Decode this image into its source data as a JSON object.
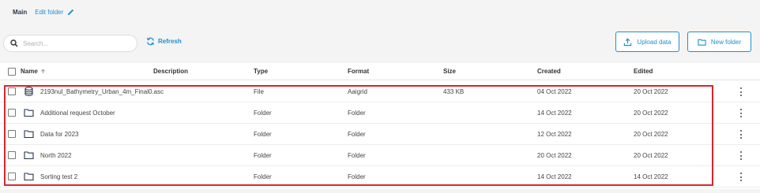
{
  "breadcrumb": {
    "main": "Main",
    "edit_folder": "Edit folder"
  },
  "toolbar": {
    "search_placeholder": "Search...",
    "refresh_label": "Refresh",
    "upload_label": "Upload data",
    "new_folder_label": "New folder"
  },
  "table": {
    "headers": {
      "name": "Name",
      "description": "Description",
      "type": "Type",
      "format": "Format",
      "size": "Size",
      "created": "Created",
      "edited": "Edited"
    },
    "rows": [
      {
        "icon": "database-file-icon",
        "name": "2193nul_Bathymetry_Urban_4m_Final0.asc",
        "type": "File",
        "format": "Aaigrid",
        "size": "433 KB",
        "created": "04 Oct 2022",
        "edited": "20 Oct 2022"
      },
      {
        "icon": "folder-icon",
        "name": "Additional request October",
        "type": "Folder",
        "format": "Folder",
        "size": "",
        "created": "14 Oct 2022",
        "edited": "20 Oct 2022"
      },
      {
        "icon": "folder-icon",
        "name": "Data for 2023",
        "type": "Folder",
        "format": "Folder",
        "size": "",
        "created": "12 Oct 2022",
        "edited": "20 Oct 2022"
      },
      {
        "icon": "folder-icon",
        "name": "North 2022",
        "type": "Folder",
        "format": "Folder",
        "size": "",
        "created": "20 Oct 2022",
        "edited": "20 Oct 2022"
      },
      {
        "icon": "folder-icon",
        "name": "Sorting test 2",
        "type": "Folder",
        "format": "Folder",
        "size": "",
        "created": "14 Oct 2022",
        "edited": "14 Oct 2022"
      }
    ]
  },
  "colors": {
    "accent": "#1f8fd0",
    "highlight": "#d9262c",
    "text": "#3a3a3a"
  }
}
